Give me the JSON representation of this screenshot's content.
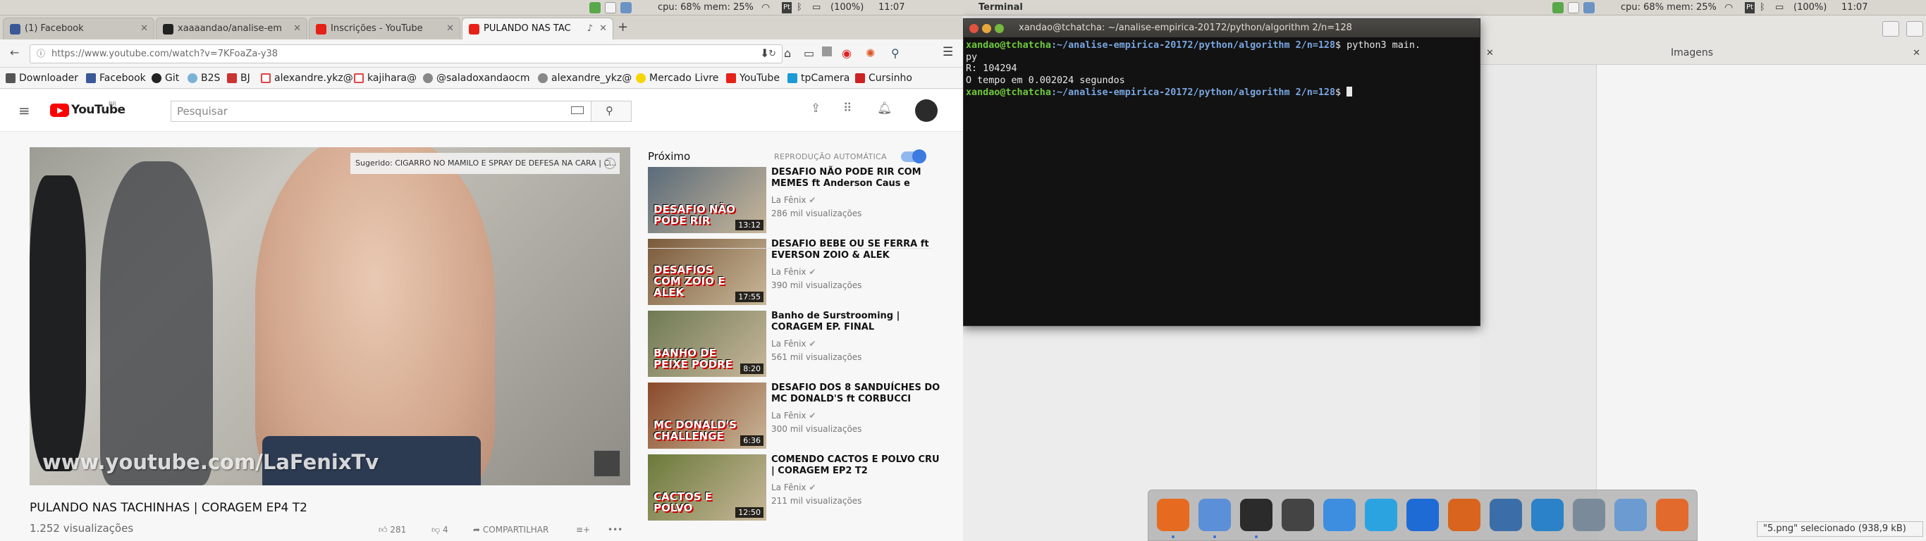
{
  "colors": {
    "terminal_bg": "#121212",
    "prompt_user": "#6fc93c",
    "prompt_path": "#7aa6e0",
    "youtube_red": "#ff0000",
    "topbar_bg": "#d9d6d0"
  },
  "topbar": {
    "left": {
      "sysinfo": "cpu: 68% mem: 25%",
      "battery": "(100%)",
      "time": "11:07"
    },
    "right": {
      "app_name": "Terminal",
      "sysinfo": "cpu: 68% mem: 25%",
      "battery": "(100%)",
      "time": "11:07"
    },
    "icons": [
      "shield-check-icon",
      "mail-icon",
      "wifi-icon",
      "pt-keyboard-icon",
      "bluetooth-icon",
      "battery-icon",
      "apple-icon"
    ]
  },
  "browser": {
    "tabs": [
      {
        "label": "(1) Facebook",
        "icon": "facebook-icon",
        "active": false
      },
      {
        "label": "xaaaandao/analise-em",
        "icon": "github-icon",
        "active": false
      },
      {
        "label": "Inscrições - YouTube",
        "icon": "youtube-icon",
        "active": false
      },
      {
        "label": "PULANDO NAS TAC",
        "icon": "youtube-icon",
        "active": true
      }
    ],
    "url": "https://www.youtube.com/watch?v=7KFoaZa-y38",
    "bookmarks": [
      {
        "label": "Downloader",
        "icon": "paw-icon"
      },
      {
        "label": "Facebook",
        "icon": "facebook-icon"
      },
      {
        "label": "Git",
        "icon": "github-icon"
      },
      {
        "label": "B2S",
        "icon": "globe-icon"
      },
      {
        "label": "BJ",
        "icon": "bj-icon"
      },
      {
        "label": "alexandre.ykz@",
        "icon": "gmail-icon"
      },
      {
        "label": "kajihara@",
        "icon": "gmail-icon"
      },
      {
        "label": "@saladoxandaocm",
        "icon": "at-icon"
      },
      {
        "label": "alexandre_ykz@",
        "icon": "at-icon"
      },
      {
        "label": "Mercado Livre",
        "icon": "mercadolivre-icon"
      },
      {
        "label": "YouTube",
        "icon": "youtube-icon"
      },
      {
        "label": "tpCamera",
        "icon": "tp-icon"
      },
      {
        "label": "Cursinho",
        "icon": "bookmark-icon"
      }
    ]
  },
  "youtube": {
    "logo_text": "YouTube",
    "logo_country": "BR",
    "search_placeholder": "Pesquisar",
    "video": {
      "title": "PULANDO NAS TACHINHAS | CORAGEM EP4 T2",
      "views": "1.252 visualizações",
      "likes": "281",
      "dislikes": "4",
      "share_label": "COMPARTILHAR",
      "watermark": "www.youtube.com/LaFenixTv",
      "suggested": "Sugerido: CIGARRO NO MAMILO E SPRAY DE DEFESA NA CARA | C..."
    },
    "next_label": "Próximo",
    "autoplay_label": "REPRODUÇÃO AUTOMÁTICA",
    "recommendations": [
      {
        "title": "DESAFIO NÃO PODE RIR COM MEMES ft Anderson Caus e",
        "channel": "La Fênix",
        "views": "286 mil visualizações",
        "duration": "13:12",
        "thumb_text": "DESAFIO NÃO PODE RIR",
        "thumb_color": "#5a6b7a"
      },
      {
        "title": "DESAFIO BEBE OU SE FERRA ft EVERSON ZOIO & ALEK",
        "channel": "La Fênix",
        "views": "390 mil visualizações",
        "duration": "17:55",
        "thumb_text": "DESAFIOS COM ZOIO E ALEK",
        "thumb_color": "#7a5a3a"
      },
      {
        "title": "Banho de Surstrooming | CORAGEM EP. FINAL",
        "channel": "La Fênix",
        "views": "561 mil visualizações",
        "duration": "8:20",
        "thumb_text": "BANHO DE PEIXE PODRE",
        "thumb_color": "#6e7a54"
      },
      {
        "title": "DESAFIO DOS 8 SANDUÍCHES DO MC DONALD'S ft CORBUCCI",
        "channel": "La Fênix",
        "views": "300 mil visualizações",
        "duration": "6:36",
        "thumb_text": "MC DONALD'S CHALLENGE",
        "thumb_color": "#8a4a2a"
      },
      {
        "title": "COMENDO CACTOS E POLVO CRU | CORAGEM EP2 T2",
        "channel": "La Fênix",
        "views": "211 mil visualizações",
        "duration": "12:50",
        "thumb_text": "CACTOS E POLVO",
        "thumb_color": "#6a7a3a"
      }
    ]
  },
  "terminal": {
    "title": "xandao@tchatcha: ~/analise-empirica-20172/python/algorithm 2/n=128",
    "lines": [
      {
        "user": "xandao@tchatcha",
        "path": ":~/analise-empirica-20172/python/algorithm 2/n=128",
        "cmd": "$ python3 main."
      },
      {
        "text": "py"
      },
      {
        "text": "R: 104294"
      },
      {
        "text": "O tempo em 0.002024 segundos"
      },
      {
        "user": "xandao@tchatcha",
        "path": ":~/analise-empirica-20172/python/algorithm 2/n=128",
        "cmd": "$ "
      }
    ]
  },
  "files": {
    "section_title": "Imagens",
    "status": "\"5.png\" selecionado  (938,9 kB)"
  },
  "dock": {
    "apps": [
      "firefox-icon",
      "finder-icon",
      "terminal-icon",
      "code-editor-icon",
      "dropbox-icon",
      "skype-icon",
      "teamviewer-icon",
      "matlab-icon",
      "postgresql-icon",
      "mysql-workbench-icon",
      "screenshot-icon",
      "virtualbox-icon",
      "network-icon"
    ]
  }
}
